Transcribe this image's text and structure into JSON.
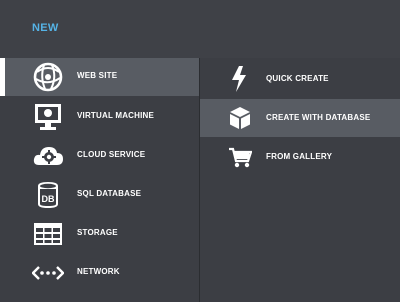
{
  "header": {
    "title": "NEW"
  },
  "categories": [
    {
      "label": "WEB SITE",
      "icon": "globe-icon",
      "selected": true
    },
    {
      "label": "VIRTUAL MACHINE",
      "icon": "monitor-icon",
      "selected": false
    },
    {
      "label": "CLOUD SERVICE",
      "icon": "cloud-gear-icon",
      "selected": false
    },
    {
      "label": "SQL DATABASE",
      "icon": "database-icon",
      "selected": false
    },
    {
      "label": "STORAGE",
      "icon": "storage-grid-icon",
      "selected": false
    },
    {
      "label": "NETWORK",
      "icon": "network-icon",
      "selected": false
    }
  ],
  "options": [
    {
      "label": "QUICK CREATE",
      "icon": "lightning-icon",
      "selected": false
    },
    {
      "label": "CREATE WITH DATABASE",
      "icon": "package-icon",
      "selected": true
    },
    {
      "label": "FROM GALLERY",
      "icon": "cart-icon",
      "selected": false
    }
  ],
  "colors": {
    "accent": "#55b3e6",
    "background": "#3c3e44",
    "selected": "#585c63"
  }
}
